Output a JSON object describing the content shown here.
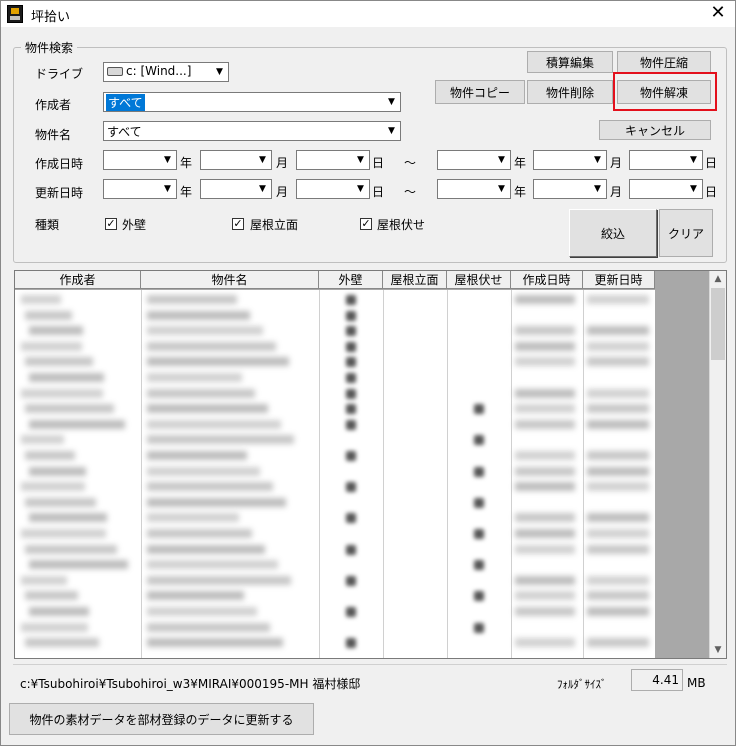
{
  "window": {
    "title": "坪拾い",
    "close_glyph": "✕"
  },
  "search": {
    "group_label": "物件検索",
    "drive_label": "ドライブ",
    "drive_value": "c: [Wind...]",
    "author_label": "作成者",
    "author_value": "すべて",
    "property_label": "物件名",
    "property_value": "すべて",
    "created_label": "作成日時",
    "updated_label": "更新日時",
    "year_unit": "年",
    "month_unit": "月",
    "day_unit": "日",
    "range_sep": "～",
    "kind_label": "種類",
    "kinds": [
      {
        "label": "外壁",
        "checked": true
      },
      {
        "label": "屋根立面",
        "checked": true
      },
      {
        "label": "屋根伏せ",
        "checked": true
      }
    ],
    "check_glyph": "✓"
  },
  "buttons": {
    "estimate_edit": "積算編集",
    "compress": "物件圧縮",
    "copy": "物件コピー",
    "delete": "物件削除",
    "unfreeze": "物件解凍",
    "cancel": "キャンセル",
    "filter": "絞込",
    "clear": "クリア",
    "update_materials": "物件の素材データを部材登録のデータに更新する"
  },
  "table": {
    "columns": [
      "作成者",
      "物件名",
      "外壁",
      "屋根立面",
      "屋根伏せ",
      "作成日時",
      "更新日時"
    ]
  },
  "status": {
    "path": "c:¥Tsubohiroi¥Tsubohiroi_w3¥MIRAI¥000195-MH  福村様邸",
    "folder_size_label": "ﾌｫﾙﾀﾞｻｲｽﾞ",
    "folder_size_value": "4.41",
    "folder_size_unit": "MB"
  },
  "colors": {
    "highlight": "#e3101c",
    "selection": "#0078d7"
  }
}
